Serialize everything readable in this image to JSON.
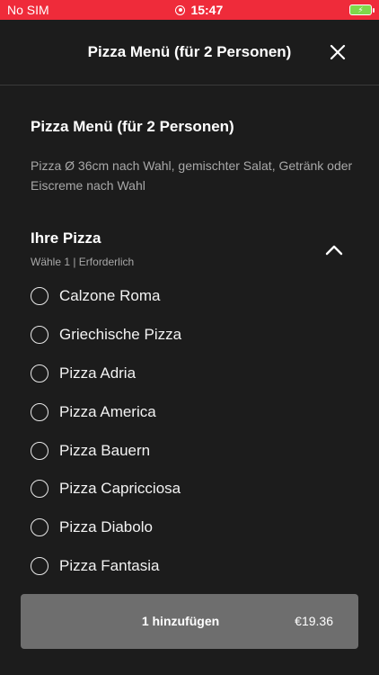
{
  "status_bar": {
    "carrier": "No SIM",
    "time": "15:47",
    "battery_symbol": "⚡"
  },
  "header": {
    "title": "Pizza Menü (für 2 Personen)"
  },
  "menu": {
    "title": "Pizza Menü (für 2 Personen)",
    "description": "Pizza Ø 36cm nach Wahl, gemischter Salat, Getränk oder Eiscreme nach Wahl"
  },
  "section": {
    "title": "Ihre Pizza",
    "subtitle": "Wähle 1  |  Erforderlich"
  },
  "options": [
    {
      "label": "Calzone Roma"
    },
    {
      "label": "Griechische Pizza"
    },
    {
      "label": "Pizza Adria"
    },
    {
      "label": "Pizza America"
    },
    {
      "label": "Pizza Bauern"
    },
    {
      "label": "Pizza Capricciosa"
    },
    {
      "label": "Pizza Diabolo"
    },
    {
      "label": "Pizza Fantasia"
    }
  ],
  "add_bar": {
    "label": "1 hinzufügen",
    "price": "€19.36"
  },
  "colors": {
    "status_bar": "#ef2b3a",
    "background": "#1c1c1c",
    "add_bar": "#6e6e6e"
  }
}
